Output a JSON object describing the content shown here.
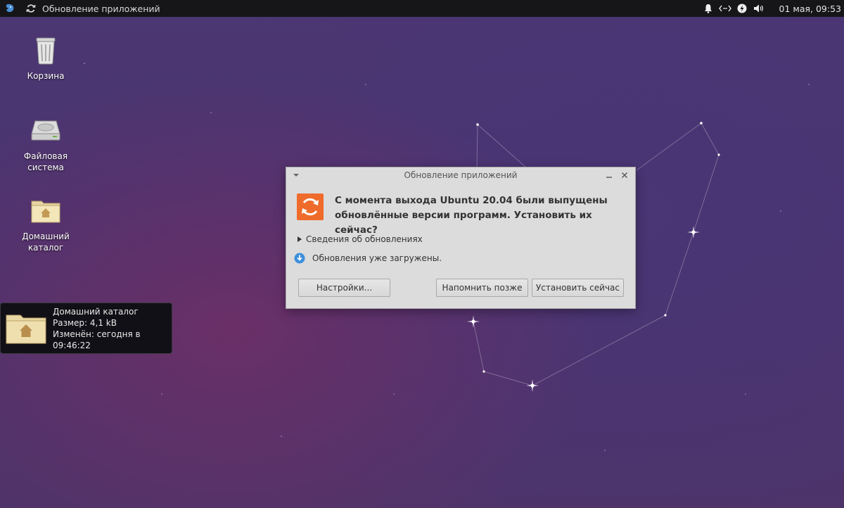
{
  "panel": {
    "window_title": "Обновление приложений",
    "clock": "01 мая, 09:53",
    "tray_icons": [
      "bell-icon",
      "network-icon",
      "power-icon",
      "volume-icon"
    ]
  },
  "desktop": {
    "icons": [
      {
        "label": "Корзина",
        "icon": "trash-icon"
      },
      {
        "label": "Файловая система",
        "icon": "drive-icon"
      },
      {
        "label": "Домашний каталог",
        "icon": "home-folder-icon"
      }
    ],
    "tooltip": {
      "name": "Домашний каталог",
      "size": "Размер: 4,1 kB",
      "modified": "Изменён: сегодня в 09:46:22"
    }
  },
  "dialog": {
    "title": "Обновление приложений",
    "headline": "С момента выхода Ubuntu 20.04 были выпущены обновлённые версии программ. Установить их сейчас?",
    "details_label": "Сведения об обновлениях",
    "status": "Обновления уже загружены.",
    "buttons": {
      "settings": "Настройки...",
      "remind_later": "Напомнить позже",
      "install_now": "Установить сейчас"
    }
  },
  "colors": {
    "accent_orange": "#ef6b2b",
    "panel_bg": "#161619",
    "dialog_bg": "#dcdcdc"
  }
}
